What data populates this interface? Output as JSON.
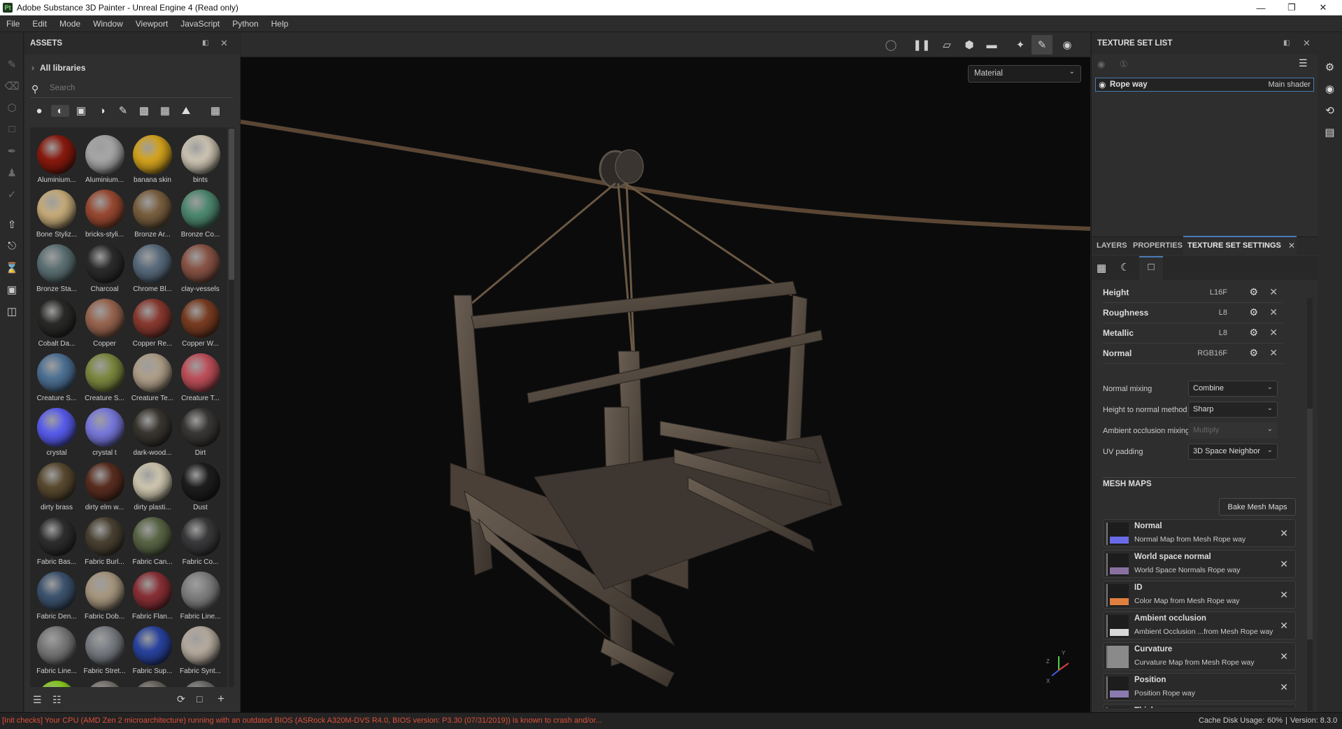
{
  "window": {
    "title": "Adobe Substance 3D Painter - Unreal Engine 4 (Read only)",
    "logo": "Pt"
  },
  "menu": [
    "File",
    "Edit",
    "Mode",
    "Window",
    "Viewport",
    "JavaScript",
    "Python",
    "Help"
  ],
  "assets": {
    "title": "ASSETS",
    "libraries": "All libraries",
    "search_placeholder": "Search",
    "items": [
      {
        "label": "Aluminium...",
        "color": "#8a1a0e"
      },
      {
        "label": "Aluminium...",
        "color": "#a8a8a8"
      },
      {
        "label": "banana skin",
        "color": "#d6a51e"
      },
      {
        "label": "bints",
        "color": "#cfc6b4"
      },
      {
        "label": "Bone Styliz...",
        "color": "#c9ae7c"
      },
      {
        "label": "bricks-styli...",
        "color": "#9a4a32"
      },
      {
        "label": "Bronze Ar...",
        "color": "#7a6040"
      },
      {
        "label": "Bronze Co...",
        "color": "#4f8a72"
      },
      {
        "label": "Bronze Sta...",
        "color": "#5e7276"
      },
      {
        "label": "Charcoal",
        "color": "#2c2c2c"
      },
      {
        "label": "Chrome Bl...",
        "color": "#5a6c7e"
      },
      {
        "label": "clay-vessels",
        "color": "#8a5446"
      },
      {
        "label": "Cobalt Da...",
        "color": "#2a2a28"
      },
      {
        "label": "Copper",
        "color": "#9a6650"
      },
      {
        "label": "Copper Re...",
        "color": "#8a3a30"
      },
      {
        "label": "Copper W...",
        "color": "#7a3c22"
      },
      {
        "label": "Creature S...",
        "color": "#4e7296"
      },
      {
        "label": "Creature S...",
        "color": "#7e8a40"
      },
      {
        "label": "Creature Te...",
        "color": "#b0a08a"
      },
      {
        "label": "Creature T...",
        "color": "#c0505a"
      },
      {
        "label": "crystal",
        "color": "#5a5ef0"
      },
      {
        "label": "crystal t",
        "color": "#7a7ae0"
      },
      {
        "label": "dark-wood...",
        "color": "#3a3630"
      },
      {
        "label": "Dirt",
        "color": "#3a3836"
      },
      {
        "label": "dirty brass",
        "color": "#5a4a30"
      },
      {
        "label": "dirty elm w...",
        "color": "#5a2e20"
      },
      {
        "label": "dirty plasti...",
        "color": "#d0c8b0"
      },
      {
        "label": "Dust",
        "color": "#1e1e1e"
      },
      {
        "label": "Fabric Bas...",
        "color": "#2e2e2e"
      },
      {
        "label": "Fabric Burl...",
        "color": "#4a4232"
      },
      {
        "label": "Fabric Can...",
        "color": "#5a6646"
      },
      {
        "label": "Fabric Co...",
        "color": "#3a3a3c"
      },
      {
        "label": "Fabric Den...",
        "color": "#3e5470"
      },
      {
        "label": "Fabric Dob...",
        "color": "#a89880"
      },
      {
        "label": "Fabric Flan...",
        "color": "#8a3036"
      },
      {
        "label": "Fabric Line...",
        "color": "#808080"
      },
      {
        "label": "Fabric Line...",
        "color": "#7a7a7a"
      },
      {
        "label": "Fabric Stret...",
        "color": "#7a7e84"
      },
      {
        "label": "Fabric Sup...",
        "color": "#2a44a0"
      },
      {
        "label": "Fabric Synt...",
        "color": "#b8ada0"
      },
      {
        "label": "",
        "color": "#8ad020"
      },
      {
        "label": "",
        "color": "#7a7670"
      },
      {
        "label": "",
        "color": "#6a6660"
      },
      {
        "label": "",
        "color": "#6e6e6c"
      }
    ]
  },
  "viewport": {
    "display_mode": "Material",
    "axis_labels": {
      "y": "Y",
      "x": "X",
      "z": "Z"
    }
  },
  "texture_set_list": {
    "title": "TEXTURE SET LIST",
    "items": [
      {
        "name": "Rope way",
        "shader": "Main shader"
      }
    ]
  },
  "tabs": [
    {
      "label": "LAYERS"
    },
    {
      "label": "PROPERTIES"
    },
    {
      "label": "TEXTURE SET SETTINGS",
      "active": true
    }
  ],
  "channels": [
    {
      "name": "Height",
      "format": "L16F"
    },
    {
      "name": "Roughness",
      "format": "L8"
    },
    {
      "name": "Metallic",
      "format": "L8"
    },
    {
      "name": "Normal",
      "format": "RGB16F"
    }
  ],
  "settings": [
    {
      "label": "Normal mixing",
      "value": "Combine",
      "disabled": false
    },
    {
      "label": "Height to normal method",
      "value": "Sharp",
      "disabled": false
    },
    {
      "label": "Ambient occlusion mixing",
      "value": "Multiply",
      "disabled": true
    },
    {
      "label": "UV padding",
      "value": "3D Space Neighbor",
      "disabled": false
    }
  ],
  "mesh_maps": {
    "title": "MESH MAPS",
    "bake_label": "Bake Mesh Maps",
    "items": [
      {
        "name": "Normal",
        "source": "Normal Map from Mesh Rope way",
        "color": "#6a6ae6"
      },
      {
        "name": "World space normal",
        "source": "World Space Normals Rope way",
        "color": "#8a70a0"
      },
      {
        "name": "ID",
        "source": "Color Map from Mesh Rope way",
        "color": "#e08040"
      },
      {
        "name": "Ambient occlusion",
        "source": "Ambient Occlusion ...from Mesh Rope way",
        "color": "#d8d8d8"
      },
      {
        "name": "Curvature",
        "source": "Curvature Map from Mesh Rope way",
        "color": "#8a8a8a"
      },
      {
        "name": "Position",
        "source": "Position Rope way",
        "color": "#8a7ab0"
      },
      {
        "name": "Thickness",
        "source": "",
        "color": "#000000"
      }
    ]
  },
  "status": {
    "message": "[Init checks] Your CPU (AMD Zen 2 microarchitecture) running with an outdated BIOS (ASRock A320M-DVS R4.0, BIOS version: P3.30 (07/31/2019)) is known to crash and/or...",
    "cache_label": "Cache Disk Usage:",
    "cache_value": "60%",
    "version": "Version: 8.3.0",
    "message_color": "#e0503a"
  }
}
